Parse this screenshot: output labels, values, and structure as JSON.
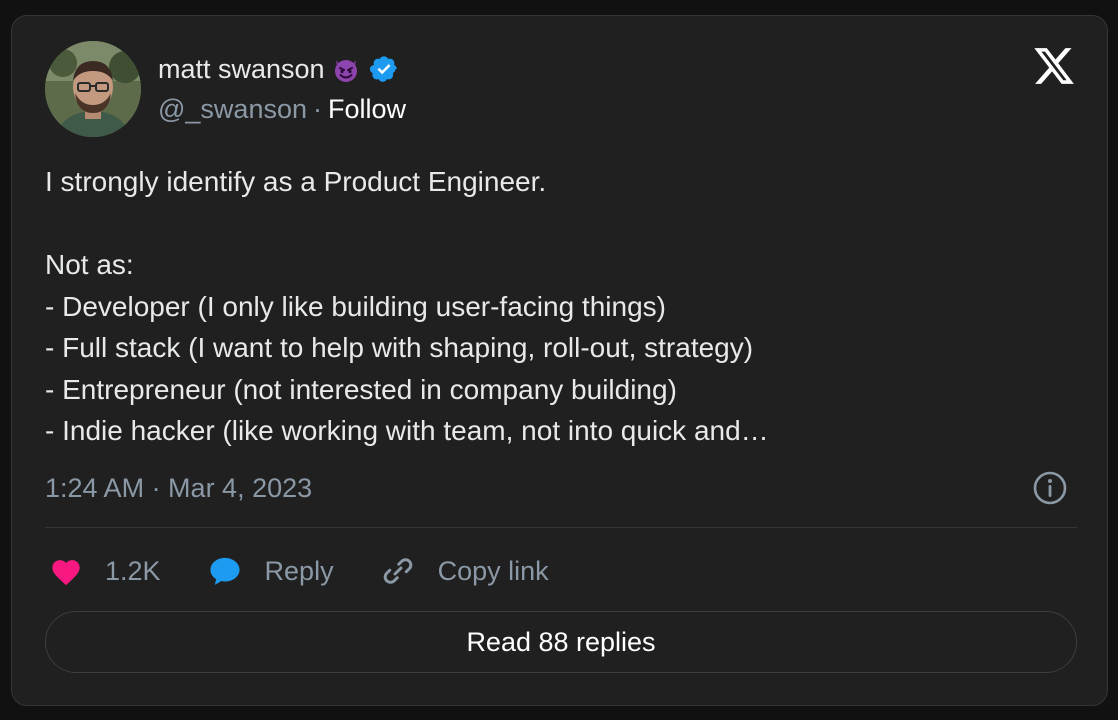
{
  "author": {
    "name": "matt swanson",
    "handle": "@_swanson",
    "separator": "·",
    "follow_label": "Follow",
    "emoji": "smiling-devil-emoji",
    "verified": true
  },
  "tweet": {
    "text": "I strongly identify as a Product Engineer.\n\nNot as:\n- Developer (I only like building user-facing things)\n- Full stack (I want to help with shaping, roll-out, strategy)\n- Entrepreneur (not interested in company building)\n- Indie hacker (like working with team, not into quick and…",
    "timestamp": "1:24 AM · Mar 4, 2023"
  },
  "actions": {
    "likes": "1.2K",
    "reply_label": "Reply",
    "copy_link_label": "Copy link"
  },
  "read_replies_label": "Read 88 replies",
  "icons": {
    "brand": "x-logo-icon",
    "info": "info-icon",
    "like": "heart-icon",
    "reply": "speech-bubble-icon",
    "copy": "link-icon"
  },
  "colors": {
    "background": "#202020",
    "text": "#e7e9ea",
    "muted": "#8b98a5",
    "heart": "#f91880",
    "reply_bubble": "#1d9bf0",
    "verified": "#1d9bf0",
    "emoji": "#8e44ad"
  }
}
